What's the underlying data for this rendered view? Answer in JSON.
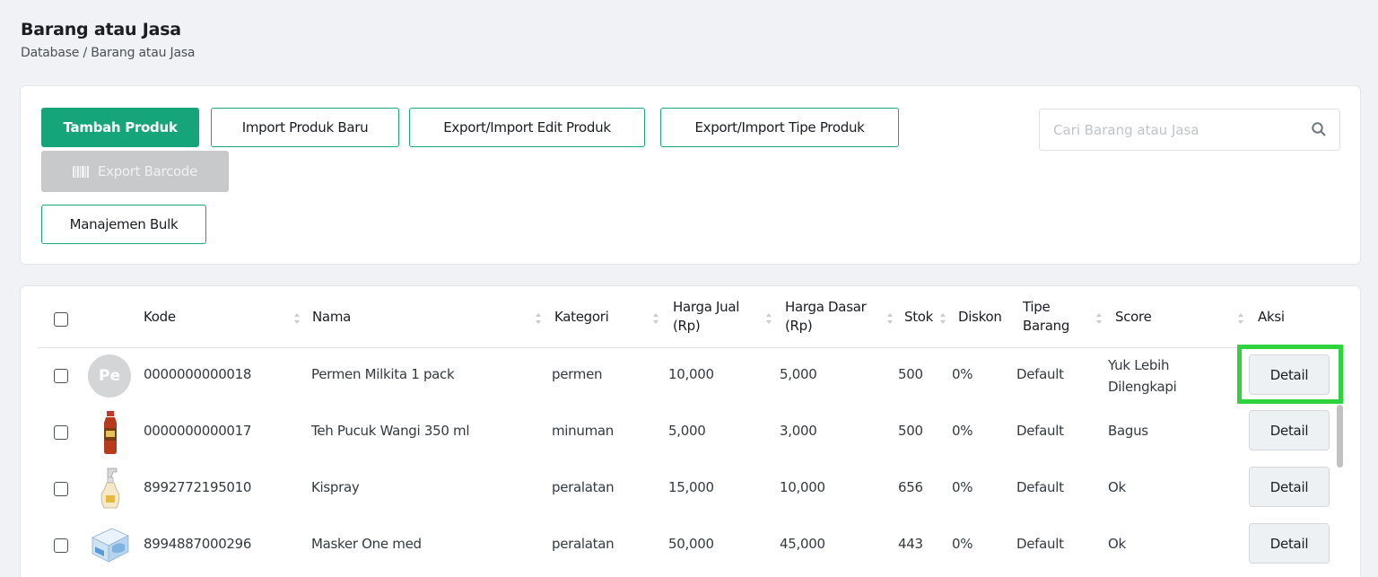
{
  "header": {
    "title": "Barang atau Jasa",
    "breadcrumb": "Database / Barang atau Jasa"
  },
  "toolbar": {
    "add_product": "Tambah Produk",
    "import_new": "Import Produk Baru",
    "export_import_edit": "Export/Import Edit Produk",
    "export_import_type": "Export/Import Tipe Produk",
    "export_barcode": "Export Barcode",
    "bulk_management": "Manajemen Bulk"
  },
  "search": {
    "placeholder": "Cari Barang atau Jasa",
    "value": ""
  },
  "table": {
    "headers": {
      "kode": "Kode",
      "nama": "Nama",
      "kategori": "Kategori",
      "harga_jual": "Harga Jual (Rp)",
      "harga_dasar": "Harga Dasar (Rp)",
      "stok": "Stok",
      "diskon": "Diskon",
      "tipe_barang": "Tipe Barang",
      "score": "Score",
      "aksi": "Aksi"
    },
    "rows": [
      {
        "image": "Pe",
        "kode": "0000000000018",
        "nama": "Permen Milkita 1 pack",
        "kategori": "permen",
        "harga_jual": "10,000",
        "harga_dasar": "5,000",
        "stok": "500",
        "diskon": "0%",
        "tipe_barang": "Default",
        "score": "Yuk Lebih Dilengkapi",
        "aksi": "Detail"
      },
      {
        "image": "tea-bottle-icon",
        "kode": "0000000000017",
        "nama": "Teh Pucuk Wangi 350 ml",
        "kategori": "minuman",
        "harga_jual": "5,000",
        "harga_dasar": "3,000",
        "stok": "500",
        "diskon": "0%",
        "tipe_barang": "Default",
        "score": "Bagus",
        "aksi": "Detail"
      },
      {
        "image": "spray-bottle-icon",
        "kode": "8992772195010",
        "nama": "Kispray",
        "kategori": "peralatan",
        "harga_jual": "15,000",
        "harga_dasar": "10,000",
        "stok": "656",
        "diskon": "0%",
        "tipe_barang": "Default",
        "score": "Ok",
        "aksi": "Detail"
      },
      {
        "image": "mask-box-icon",
        "kode": "8994887000296",
        "nama": "Masker One med",
        "kategori": "peralatan",
        "harga_jual": "50,000",
        "harga_dasar": "45,000",
        "stok": "443",
        "diskon": "0%",
        "tipe_barang": "Default",
        "score": "Ok",
        "aksi": "Detail"
      }
    ]
  },
  "colors": {
    "primary": "#16a57a",
    "highlight": "#2ed33d",
    "disabled": "#c8c9cb"
  }
}
